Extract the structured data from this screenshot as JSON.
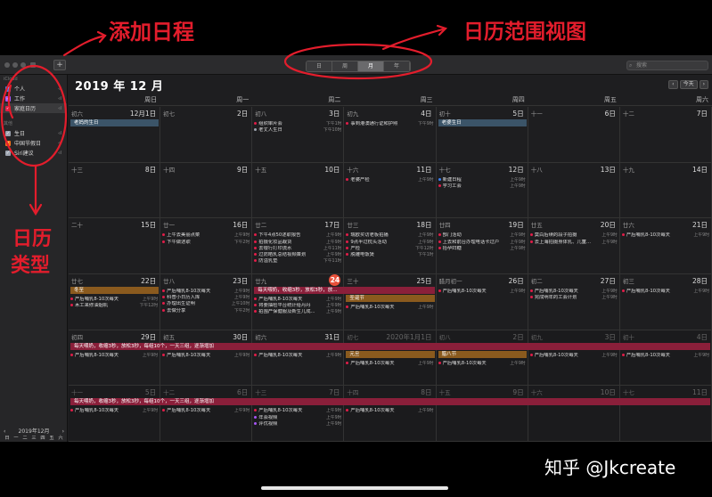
{
  "toolbar": {
    "add": "+",
    "views": [
      "日",
      "周",
      "月",
      "年"
    ],
    "active_view": 2,
    "search_placeholder": "搜索"
  },
  "sidebar": {
    "section1": "iCloud",
    "cals1": [
      {
        "label": "个人",
        "color": "#3b82f6"
      },
      {
        "label": "工作",
        "color": "#a855f7"
      },
      {
        "label": "家庭日历",
        "color": "#e11d48",
        "sel": true
      }
    ],
    "section2": "其他",
    "cals2": [
      {
        "label": "生日",
        "color": "#9ca3af"
      },
      {
        "label": "中国节假日",
        "color": "#f97316"
      },
      {
        "label": "Siri建议",
        "color": "#9ca3af"
      }
    ]
  },
  "mini": {
    "title": "2019年12月",
    "prev": "‹",
    "next": "›",
    "heads": [
      "日",
      "一",
      "二",
      "三",
      "四",
      "五",
      "六"
    ],
    "days": [
      "1",
      "2",
      "3",
      "4",
      "5",
      "6",
      "7",
      "8",
      "9",
      "10",
      "11",
      "12",
      "13",
      "14",
      "15",
      "16",
      "17",
      "18",
      "19",
      "20",
      "21",
      "22",
      "23",
      "24",
      "25",
      "26",
      "27",
      "28",
      "29",
      "30",
      "31",
      "1",
      "2",
      "3",
      "4"
    ],
    "today": "24"
  },
  "main": {
    "title": "2019 年 12 月",
    "prev": "‹",
    "today": "今天",
    "next": "›",
    "weekdays": [
      "周日",
      "周一",
      "周二",
      "周三",
      "周四",
      "周五",
      "周六"
    ]
  },
  "cells": [
    {
      "l": "初六",
      "d": "12月1日",
      "ev": []
    },
    {
      "l": "初七",
      "d": "2日",
      "ev": []
    },
    {
      "l": "初八",
      "d": "3日",
      "ev": [
        {
          "t": "组织审片会",
          "c": "#e11d48",
          "time": "下午1时"
        },
        {
          "t": "老丈人生日",
          "c": "#9ca3af",
          "time": "下午10时"
        }
      ]
    },
    {
      "l": "初九",
      "d": "4日",
      "ev": [
        {
          "t": "事到港澳通行证和护照",
          "c": "#e11d48",
          "time": "下午9时"
        }
      ]
    },
    {
      "l": "初十",
      "d": "5日",
      "ev": []
    },
    {
      "l": "十一",
      "d": "6日",
      "ev": []
    },
    {
      "l": "十二",
      "d": "7日",
      "ev": []
    },
    {
      "l": "十三",
      "d": "8日",
      "ev": []
    },
    {
      "l": "十四",
      "d": "9日",
      "ev": []
    },
    {
      "l": "十五",
      "d": "10日",
      "ev": []
    },
    {
      "l": "十六",
      "d": "11日",
      "ev": [
        {
          "t": "老婆产检",
          "c": "#e11d48",
          "time": "上午9时"
        }
      ]
    },
    {
      "l": "十七",
      "d": "12日",
      "ev": [
        {
          "t": "新建日程",
          "c": "#3b82f6",
          "time": "上午9时"
        },
        {
          "t": "学习工会",
          "c": "#e11d48",
          "time": "上午9时"
        }
      ]
    },
    {
      "l": "十八",
      "d": "13日",
      "ev": []
    },
    {
      "l": "十九",
      "d": "14日",
      "ev": []
    },
    {
      "l": "二十",
      "d": "15日",
      "ev": []
    },
    {
      "l": "廿一",
      "d": "16日",
      "ev": [
        {
          "t": "上午去美丽点菜",
          "c": "#e11d48",
          "time": "上午9时"
        },
        {
          "t": "下午做述职",
          "c": "#e11d48",
          "time": "下午2时"
        }
      ]
    },
    {
      "l": "廿二",
      "d": "17日",
      "ev": [
        {
          "t": "下午4点50述职报告",
          "c": "#e11d48",
          "time": "上午9时"
        },
        {
          "t": "拍摄化妆品栽货",
          "c": "#e11d48",
          "time": "上午9时"
        },
        {
          "t": "去银行打印流水",
          "c": "#e11d48",
          "time": "上午11时"
        },
        {
          "t": "过防晒乳总结视频策划",
          "c": "#e11d48",
          "time": "上午9时"
        },
        {
          "t": "防溢乳垫",
          "c": "#e11d48",
          "time": "下午11时"
        }
      ]
    },
    {
      "l": "廿三",
      "d": "18日",
      "ev": [
        {
          "t": "瑞欧买访老板拍播",
          "c": "#e11d48",
          "time": "上午9时"
        },
        {
          "t": "9点半过枕头活动",
          "c": "#e11d48",
          "time": "上午9时"
        },
        {
          "t": "产检",
          "c": "#e11d48",
          "time": "下午12时"
        },
        {
          "t": "脱雕电饭煲",
          "c": "#e11d48",
          "time": "下午1时"
        }
      ]
    },
    {
      "l": "廿四",
      "d": "19日",
      "ev": [
        {
          "t": "部门活动",
          "c": "#e11d48",
          "time": "上午9时"
        },
        {
          "t": "上去和前台办理电话卡过户",
          "c": "#e11d48",
          "time": "上午9时"
        },
        {
          "t": "抬孕妇糖",
          "c": "#e11d48",
          "time": "上午9时"
        }
      ]
    },
    {
      "l": "廿五",
      "d": "20日",
      "ev": [
        {
          "t": "莫白后续的段子拍摄",
          "c": "#e11d48",
          "time": "上午9时"
        },
        {
          "t": "去上海拍摄身体乳、儿童...",
          "c": "#e11d48",
          "time": "上午9时"
        }
      ]
    },
    {
      "l": "廿六",
      "d": "21日",
      "ev": [
        {
          "t": "产后哺乳8-10次每天",
          "c": "#e11d48",
          "time": "上午9时"
        }
      ]
    },
    {
      "l": "廿七",
      "d": "22日",
      "ev": [
        {
          "t": "产后哺乳8-10次每天",
          "c": "#e11d48",
          "time": "上午9时"
        },
        {
          "t": "木工来修油烟机",
          "c": "#e11d48",
          "time": "下午12时"
        }
      ]
    },
    {
      "l": "廿八",
      "d": "23日",
      "ev": [
        {
          "t": "产后哺乳8-10次每天",
          "c": "#e11d48",
          "time": "上午9时"
        },
        {
          "t": "科普小日历入库",
          "c": "#e11d48",
          "time": "上午9时"
        },
        {
          "t": "办理出生证明",
          "c": "#e11d48",
          "time": "上午10时"
        },
        {
          "t": "去做分享",
          "c": "#e11d48",
          "time": "下午2时"
        }
      ]
    },
    {
      "l": "廿九",
      "d": "24",
      "today": true,
      "ev": [
        {
          "t": "产后哺乳8-10次每天",
          "c": "#e11d48",
          "time": "上午9时"
        },
        {
          "t": "将要抽检平台统计给丹丹",
          "c": "#e11d48",
          "time": "上午9时"
        },
        {
          "t": "拍围产保健服及新生儿成...",
          "c": "#e11d48",
          "time": "上午9时"
        }
      ]
    },
    {
      "l": "三十",
      "d": "25日",
      "ev": [
        {
          "t": "产后哺乳8-10次每天",
          "c": "#e11d48",
          "time": "上午9时"
        }
      ]
    },
    {
      "l": "腊月初一",
      "d": "26日",
      "ev": [
        {
          "t": "产后哺乳8-10次每天",
          "c": "#e11d48",
          "time": "上午9时"
        }
      ]
    },
    {
      "l": "初二",
      "d": "27日",
      "ev": [
        {
          "t": "产后哺乳8-10次每天",
          "c": "#e11d48",
          "time": "上午9时"
        },
        {
          "t": "完成明年的工会计划",
          "c": "#e11d48",
          "time": "上午9时"
        }
      ]
    },
    {
      "l": "初三",
      "d": "28日",
      "ev": [
        {
          "t": "产后哺乳8-10次每天",
          "c": "#e11d48",
          "time": "上午9时"
        }
      ]
    },
    {
      "l": "初四",
      "d": "29日",
      "ev": [
        {
          "t": "产后哺乳8-10次每天",
          "c": "#e11d48",
          "time": "上午9时"
        }
      ]
    },
    {
      "l": "初五",
      "d": "30日",
      "ev": [
        {
          "t": "产后哺乳8-10次每天",
          "c": "#e11d48",
          "time": "上午9时"
        }
      ]
    },
    {
      "l": "初六",
      "d": "31日",
      "ev": [
        {
          "t": "产后哺乳8-10次每天",
          "c": "#e11d48",
          "time": "上午9时"
        }
      ]
    },
    {
      "l": "初七",
      "d": "2020年1月1日",
      "dim": true,
      "ev": [
        {
          "t": "产后哺乳8-10次每天",
          "c": "#e11d48",
          "time": "上午9时"
        }
      ]
    },
    {
      "l": "初八",
      "d": "2日",
      "dim": true,
      "ev": [
        {
          "t": "产后哺乳8-10次每天",
          "c": "#e11d48",
          "time": "上午9时"
        }
      ]
    },
    {
      "l": "初九",
      "d": "3日",
      "dim": true,
      "ev": [
        {
          "t": "产后哺乳8-10次每天",
          "c": "#e11d48",
          "time": "上午9时"
        }
      ]
    },
    {
      "l": "初十",
      "d": "4日",
      "dim": true,
      "ev": [
        {
          "t": "产后哺乳8-10次每天",
          "c": "#e11d48",
          "time": "上午9时"
        }
      ]
    },
    {
      "l": "十一",
      "d": "5日",
      "dim": true,
      "ev": [
        {
          "t": "产后哺乳8-10次每天",
          "c": "#e11d48",
          "time": "上午9时"
        }
      ]
    },
    {
      "l": "十二",
      "d": "6日",
      "dim": true,
      "ev": [
        {
          "t": "产后哺乳8-10次每天",
          "c": "#e11d48",
          "time": "上午9时"
        }
      ]
    },
    {
      "l": "十三",
      "d": "7日",
      "dim": true,
      "ev": [
        {
          "t": "产后哺乳8-10次每天",
          "c": "#e11d48",
          "time": "上午9时"
        },
        {
          "t": "年会视频",
          "c": "#a855f7",
          "time": "上午9时"
        },
        {
          "t": "评优视频",
          "c": "#a855f7",
          "time": "上午9时"
        }
      ]
    },
    {
      "l": "十四",
      "d": "8日",
      "dim": true,
      "ev": [
        {
          "t": "产后哺乳8-10次每天",
          "c": "#e11d48",
          "time": "上午9时"
        }
      ]
    },
    {
      "l": "十五",
      "d": "9日",
      "dim": true,
      "ev": []
    },
    {
      "l": "十六",
      "d": "10日",
      "dim": true,
      "ev": []
    },
    {
      "l": "十七",
      "d": "11日",
      "dim": true,
      "ev": []
    }
  ],
  "bands": [
    {
      "row": 0,
      "col": 0,
      "span": 1,
      "text": "老妈的生日",
      "color": "#3b5468"
    },
    {
      "row": 0,
      "col": 4,
      "span": 1,
      "text": "老婆生日",
      "color": "#3b5468"
    },
    {
      "row": 3,
      "col": 0,
      "span": 1,
      "text": "冬至",
      "color": "#8a5a1e"
    },
    {
      "row": 3,
      "col": 2,
      "span": 2,
      "text": "每天喂奶，收缩3秒，放松3秒，放...",
      "color": "#8a1f3a"
    },
    {
      "row": 3,
      "col": 3,
      "span": 1,
      "text": "圣诞节",
      "color": "#8a5a1e"
    },
    {
      "row": 4,
      "col": 0,
      "span": 7,
      "text": "每天喂奶，收缩3秒，放松3秒，每组10个，一天三组，逐渐增加",
      "color": "#8a1f3a"
    },
    {
      "row": 4,
      "col": 3,
      "span": 1,
      "text": "元旦",
      "color": "#8a5a1e"
    },
    {
      "row": 4,
      "col": 4,
      "span": 1,
      "text": "腊八节",
      "color": "#8a5a1e"
    },
    {
      "row": 5,
      "col": 0,
      "span": 7,
      "text": "每天喂奶，收缩3秒，放松3秒，每组10个，一天三组，逐渐增加",
      "color": "#8a1f3a"
    }
  ],
  "annotations": {
    "add": "添加日程",
    "range": "日历范围视图",
    "type1": "日历",
    "type2": "类型"
  },
  "watermark": "知乎 @Jkcreate"
}
